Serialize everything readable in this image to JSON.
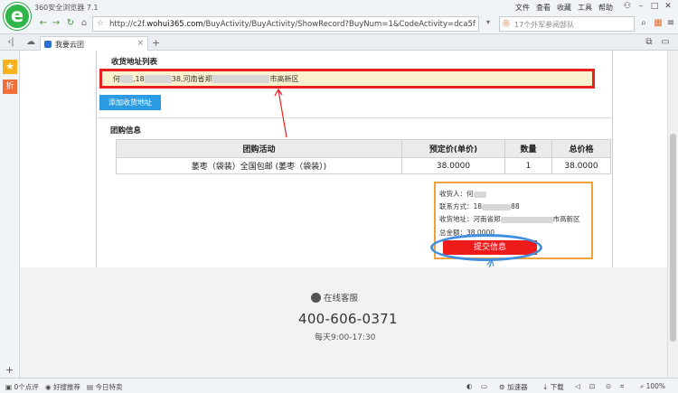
{
  "browser": {
    "app_title": "360安全浏览器 7.1",
    "menu": [
      "文件",
      "查看",
      "收藏",
      "工具",
      "帮助"
    ],
    "url_prefix": "http://c2f.",
    "url_domain": "wohui365.com",
    "url_rest": "/BuyActivity/BuyActivity/ShowRecord?BuyNum=1&CodeActivity=dca5fab",
    "search_placeholder": "17个外军参阅部队",
    "tab_title": "我要云团"
  },
  "page": {
    "address_section_title": "收货地址列表",
    "address_line": {
      "prefix": "何",
      "mid1": ",18",
      "mid2": "38,河南省郑",
      "suffix": "市高新区"
    },
    "add_address_button": "添加收货地址",
    "group_section_title": "团购信息",
    "table": {
      "headers": [
        "团购活动",
        "预定价(单价)",
        "数量",
        "总价格"
      ],
      "rows": [
        [
          "萎枣（袋装）全国包邮 (萎枣（袋装）)",
          "38.0000",
          "1",
          "38.0000"
        ]
      ]
    },
    "summary": {
      "receiver_label": "收货人：",
      "receiver_value": "何",
      "phone_label": "联系方式：",
      "phone_value": "18",
      "phone_tail": "88",
      "address_label": "收货地址：",
      "address_value": "河南省郑",
      "address_tail": "市高新区",
      "total_label": "总金额：",
      "total_value": "38.0000",
      "submit_button": "提交信息"
    },
    "footer": {
      "online_service": "在线客服",
      "phone": "400-606-0371",
      "hours": "每天9:00-17:30"
    }
  },
  "statusbar": {
    "comments": "0个点评",
    "recommend": "好搜推荐",
    "today": "今日特卖",
    "accelerator": "加速器",
    "download": "下载",
    "zoom": "100%"
  },
  "colors": {
    "highlight_red": "#e8231f",
    "highlight_blue": "#3f8fe0",
    "highlight_orange": "#f0a23a",
    "submit_red": "#ee1b1b",
    "add_button_blue": "#2b9be2"
  }
}
